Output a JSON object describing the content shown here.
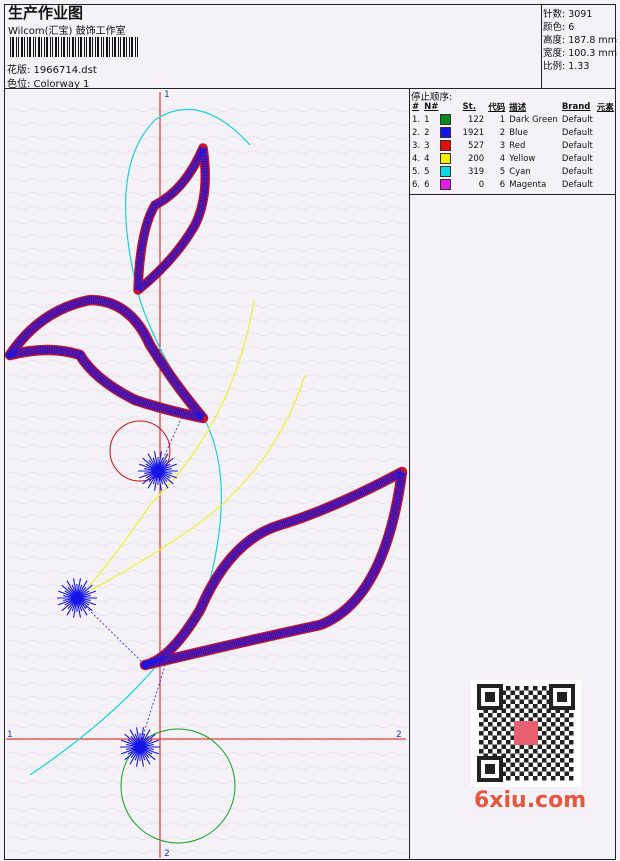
{
  "header": {
    "title": "生产作业图",
    "company": "Wilcom(汇宝) 鼓饰工作室",
    "design_label": "花版: 1966714.dst",
    "colorway_label": "色位: Colorway 1"
  },
  "stats": [
    {
      "label": "针数: 3091"
    },
    {
      "label": "颜色: 6"
    },
    {
      "label": "高度: 187.8 mm"
    },
    {
      "label": "宽度: 100.3 mm"
    },
    {
      "label": "比例: 1.33"
    }
  ],
  "stop_sequence": {
    "heading": "停止顺序:",
    "columns": [
      "#",
      "N#",
      "St.",
      "代码",
      "描述",
      "Brand",
      "元素"
    ],
    "rows": [
      {
        "idx": "1.",
        "n": "1",
        "st": "122",
        "code": "1",
        "desc": "Dark Green",
        "brand": "Default",
        "color": "#0a8a1e"
      },
      {
        "idx": "2.",
        "n": "2",
        "st": "1921",
        "code": "2",
        "desc": "Blue",
        "brand": "Default",
        "color": "#1414e6"
      },
      {
        "idx": "3.",
        "n": "3",
        "st": "527",
        "code": "3",
        "desc": "Red",
        "brand": "Default",
        "color": "#e01010"
      },
      {
        "idx": "4.",
        "n": "4",
        "st": "200",
        "code": "4",
        "desc": "Yellow",
        "brand": "Default",
        "color": "#f0f000"
      },
      {
        "idx": "5.",
        "n": "5",
        "st": "319",
        "code": "5",
        "desc": "Cyan",
        "brand": "Default",
        "color": "#10d8e0"
      },
      {
        "idx": "6.",
        "n": "6",
        "st": "0",
        "code": "6",
        "desc": "Magenta",
        "brand": "Default",
        "color": "#e020e0"
      }
    ]
  },
  "axes": {
    "v_top": "1",
    "v_bottom": "2",
    "h_left": "1",
    "h_right": "2"
  },
  "colors": {
    "axis": "#e01010",
    "fill_blue": "#1414e6",
    "outline_red": "#c81428",
    "cyan": "#18d0e0",
    "yellow": "#f0f040",
    "green": "#10a020"
  },
  "watermark": "6xiu.com",
  "qr_stamp": "QR code"
}
